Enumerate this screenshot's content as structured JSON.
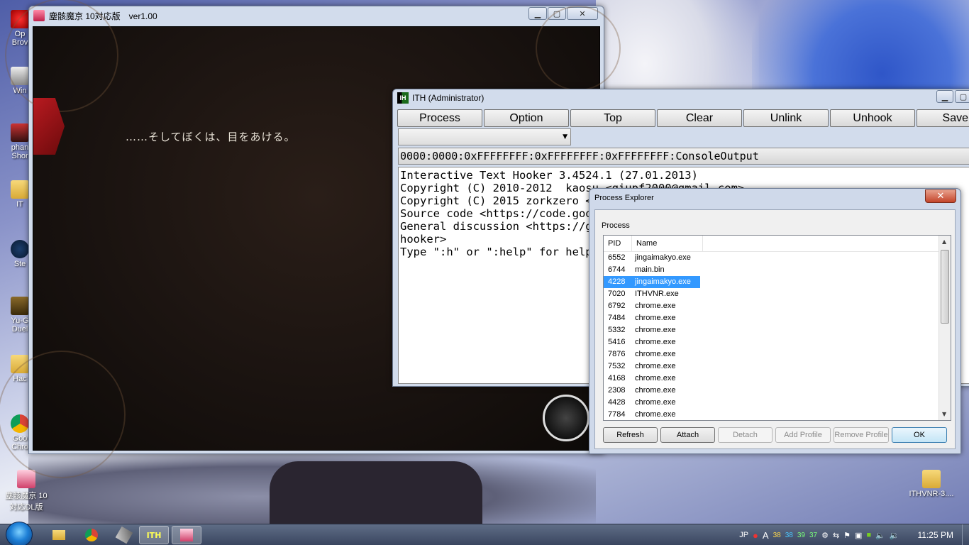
{
  "desktop": {
    "icons_left": [
      {
        "label": "Op\nBrov",
        "icon": "opera-icon"
      },
      {
        "label": "Win",
        "icon": "app-icon"
      },
      {
        "label": "phan\nShor",
        "icon": "shortcut-icon"
      },
      {
        "label": "IT",
        "icon": "folder-icon"
      },
      {
        "label": "Ste",
        "icon": "steam-icon"
      },
      {
        "label": "Yu-G\nDuel",
        "icon": "game-icon"
      },
      {
        "label": "Hac",
        "icon": "folder-icon"
      },
      {
        "label": "Goo\nChro",
        "icon": "chrome-icon"
      }
    ],
    "icon_bottom_left": "塵骸魔京 10\n対応DL版",
    "icon_bottom_right": "ITHVNR-3...."
  },
  "game_window": {
    "title": "塵骸魔京 10対応版　ver1.00",
    "dialogue": "……そしてぼくは、目をあける。",
    "controls": {
      "minimize": "▁",
      "maximize": "▢",
      "close": "✕"
    }
  },
  "ith_window": {
    "title": "ITH (Administrator)",
    "toolbar": [
      "Process",
      "Option",
      "Top",
      "Clear",
      "Unlink",
      "Unhook",
      "Save"
    ],
    "thread_line": "0000:0000:0xFFFFFFFF:0xFFFFFFFF:0xFFFFFFFF:ConsoleOutput",
    "console": "Interactive Text Hooker 3.4524.1 (27.01.2013)\nCopyright (C) 2010-2012  kaosu <qiupf2000@gmail.com>\nCopyright (C) 2015 zorkzero <z\nSource code <https://code.goog\nGeneral discussion <https://gr\nhooker>\nType \":h\" or \":help\" for help."
  },
  "process_explorer": {
    "title": "Process Explorer",
    "group_label": "Process",
    "columns": [
      "PID",
      "Name"
    ],
    "rows": [
      {
        "pid": "6552",
        "name": "jingaimakyo.exe"
      },
      {
        "pid": "6744",
        "name": "main.bin"
      },
      {
        "pid": "4228",
        "name": "jingaimakyo.exe",
        "selected": true
      },
      {
        "pid": "7020",
        "name": "ITHVNR.exe"
      },
      {
        "pid": "6792",
        "name": "chrome.exe"
      },
      {
        "pid": "7484",
        "name": "chrome.exe"
      },
      {
        "pid": "5332",
        "name": "chrome.exe"
      },
      {
        "pid": "5416",
        "name": "chrome.exe"
      },
      {
        "pid": "7876",
        "name": "chrome.exe"
      },
      {
        "pid": "7532",
        "name": "chrome.exe"
      },
      {
        "pid": "4168",
        "name": "chrome.exe"
      },
      {
        "pid": "2308",
        "name": "chrome.exe"
      },
      {
        "pid": "4428",
        "name": "chrome.exe"
      },
      {
        "pid": "7784",
        "name": "chrome.exe"
      }
    ],
    "buttons": {
      "refresh": "Refresh",
      "attach": "Attach",
      "detach": "Detach",
      "add_profile": "Add Profile",
      "remove_profile": "Remove Profile",
      "ok": "OK"
    },
    "close": "✕"
  },
  "taskbar": {
    "tray": {
      "language": "JP",
      "ime": "A",
      "temps": [
        "38",
        "38",
        "39",
        "37"
      ],
      "clock": "11:25 PM"
    },
    "temp_colors": [
      "#ffd84a",
      "#4ac8ff",
      "#7aff7a",
      "#7aff7a"
    ],
    "ith_label": "ITH"
  }
}
